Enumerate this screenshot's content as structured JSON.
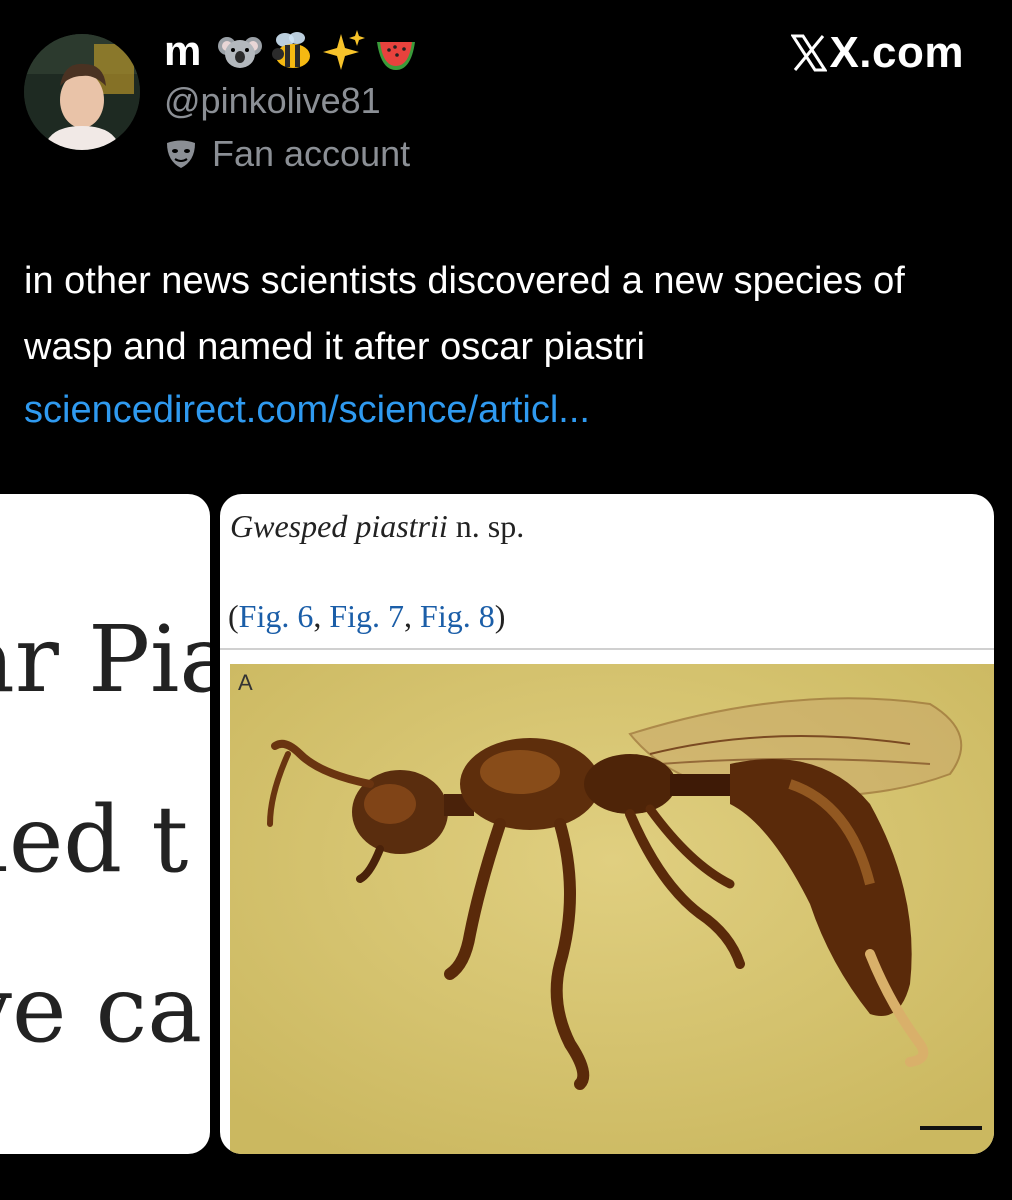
{
  "header": {
    "display_name": "m",
    "emojis": [
      "koala-emoji",
      "bee-emoji",
      "sparkles-emoji",
      "watermelon-emoji"
    ],
    "handle": "@pinkolive81",
    "account_label": "Fan account",
    "label_icon": "mask-icon",
    "brand": "X.com"
  },
  "tweet": {
    "text": "in other news scientists discovered a new species of wasp and named it after oscar piastri",
    "link": "sciencedirect.com/science/articl..."
  },
  "media": {
    "left_crop": {
      "lines": [
        "ar Pia",
        "lled t",
        "ve ca"
      ]
    },
    "right_crop": {
      "species_genus": "Gwesped piastrii",
      "species_suffix": "n. sp.",
      "fig_open": "(",
      "figs": [
        "Fig. 6",
        "Fig. 7",
        "Fig. 8"
      ],
      "fig_sep": ", ",
      "fig_close": ")",
      "panel_letter": "A"
    }
  },
  "colors": {
    "background": "#000000",
    "link": "#2f9af0",
    "muted": "#8b8f95",
    "amber": "#d8c673"
  }
}
